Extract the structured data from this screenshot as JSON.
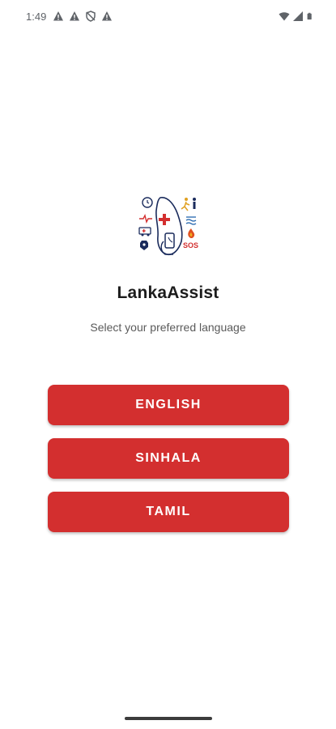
{
  "status_bar": {
    "time": "1:49",
    "left_icons": [
      "warning-icon",
      "warning-icon",
      "shield-icon",
      "warning-icon"
    ],
    "right_icons": [
      "wifi-icon",
      "signal-icon",
      "battery-icon"
    ]
  },
  "app": {
    "logo_text": "SOS",
    "title": "LankaAssist",
    "subtitle": "Select your preferred language"
  },
  "languages": {
    "english_label": "ENGLISH",
    "sinhala_label": "SINHALA",
    "tamil_label": "TAMIL"
  },
  "colors": {
    "accent": "#d32f2f",
    "navy": "#1a2b5c",
    "text_primary": "#1c1c1c",
    "text_secondary": "#5a5a5a"
  }
}
